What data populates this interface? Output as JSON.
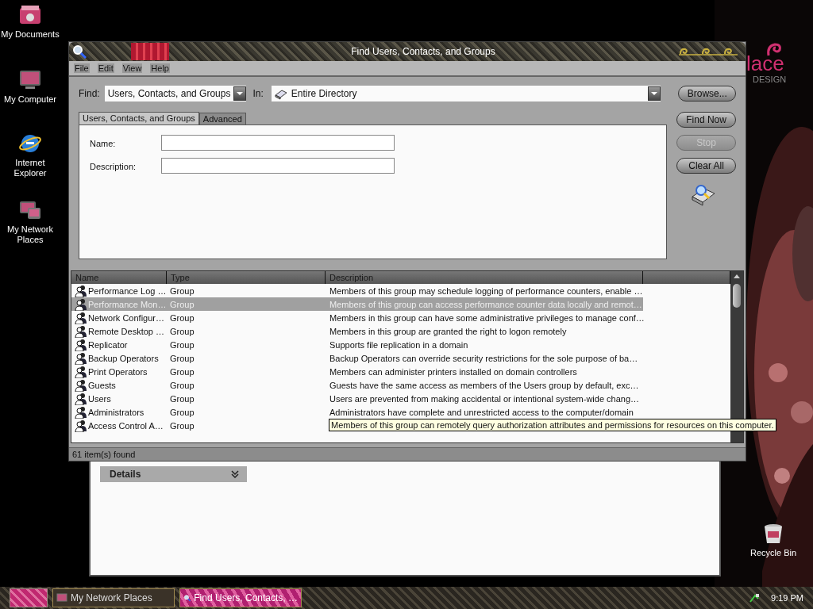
{
  "desktop_icons": [
    {
      "label": "My Documents",
      "kind": "documents"
    },
    {
      "label": "My Computer",
      "kind": "computer"
    },
    {
      "label": "Internet Explorer",
      "kind": "browser"
    },
    {
      "label": "My Network Places",
      "kind": "network"
    },
    {
      "label": "Recycle Bin",
      "kind": "recycle"
    }
  ],
  "wallpaper": {
    "logo_text": "lace",
    "logo_subtext": "DESIGN"
  },
  "background_window": {
    "panel_title": "Details"
  },
  "window": {
    "title": "Find Users, Contacts, and Groups"
  },
  "menu": [
    "File",
    "Edit",
    "View",
    "Help"
  ],
  "find": {
    "label": "Find:",
    "value": "Users, Contacts, and Groups"
  },
  "in": {
    "label": "In:",
    "value": "Entire Directory"
  },
  "browse_button": "Browse...",
  "tabs": [
    {
      "label": "Users, Contacts, and Groups",
      "selected": true
    },
    {
      "label": "Advanced",
      "selected": false
    }
  ],
  "fields": [
    {
      "label": "Name:"
    },
    {
      "label": "Description:"
    }
  ],
  "side_buttons": [
    {
      "label": "Find Now",
      "disabled": false
    },
    {
      "label": "Stop",
      "disabled": true
    },
    {
      "label": "Clear All",
      "disabled": false
    }
  ],
  "results": {
    "columns": [
      "Name",
      "Type",
      "Description"
    ],
    "rows": [
      {
        "name": "Performance Log …",
        "type": "Group",
        "description": "Members of this group may schedule logging of performance counters, enable …",
        "selected": false
      },
      {
        "name": "Performance Mon…",
        "type": "Group",
        "description": "Members of this group can access performance counter data locally and remot…",
        "selected": true
      },
      {
        "name": "Network Configur…",
        "type": "Group",
        "description": "Members in this group can have some administrative privileges to manage conf…",
        "selected": false
      },
      {
        "name": "Remote Desktop …",
        "type": "Group",
        "description": "Members in this group are granted the right to logon remotely",
        "selected": false
      },
      {
        "name": "Replicator",
        "type": "Group",
        "description": "Supports file replication in a domain",
        "selected": false
      },
      {
        "name": "Backup Operators",
        "type": "Group",
        "description": "Backup Operators can override security restrictions for the sole purpose of ba…",
        "selected": false
      },
      {
        "name": "Print Operators",
        "type": "Group",
        "description": "Members can administer printers installed on domain controllers",
        "selected": false
      },
      {
        "name": "Guests",
        "type": "Group",
        "description": "Guests have the same access as members of the Users group by default, exc…",
        "selected": false
      },
      {
        "name": "Users",
        "type": "Group",
        "description": "Users are prevented from making accidental or intentional system-wide chang…",
        "selected": false
      },
      {
        "name": "Administrators",
        "type": "Group",
        "description": "Administrators have complete and unrestricted access to the computer/domain",
        "selected": false
      },
      {
        "name": "Access Control A…",
        "type": "Group",
        "selected": false
      }
    ],
    "tooltip": "Members of this group can remotely query authorization attributes and permissions for resources on this computer."
  },
  "status_bar": "61 item(s) found",
  "taskbar": {
    "buttons": [
      {
        "label": "My Network Places",
        "selected": false
      },
      {
        "label": "Find Users, Contacts, …",
        "selected": true
      }
    ],
    "clock": "9:19 PM"
  }
}
